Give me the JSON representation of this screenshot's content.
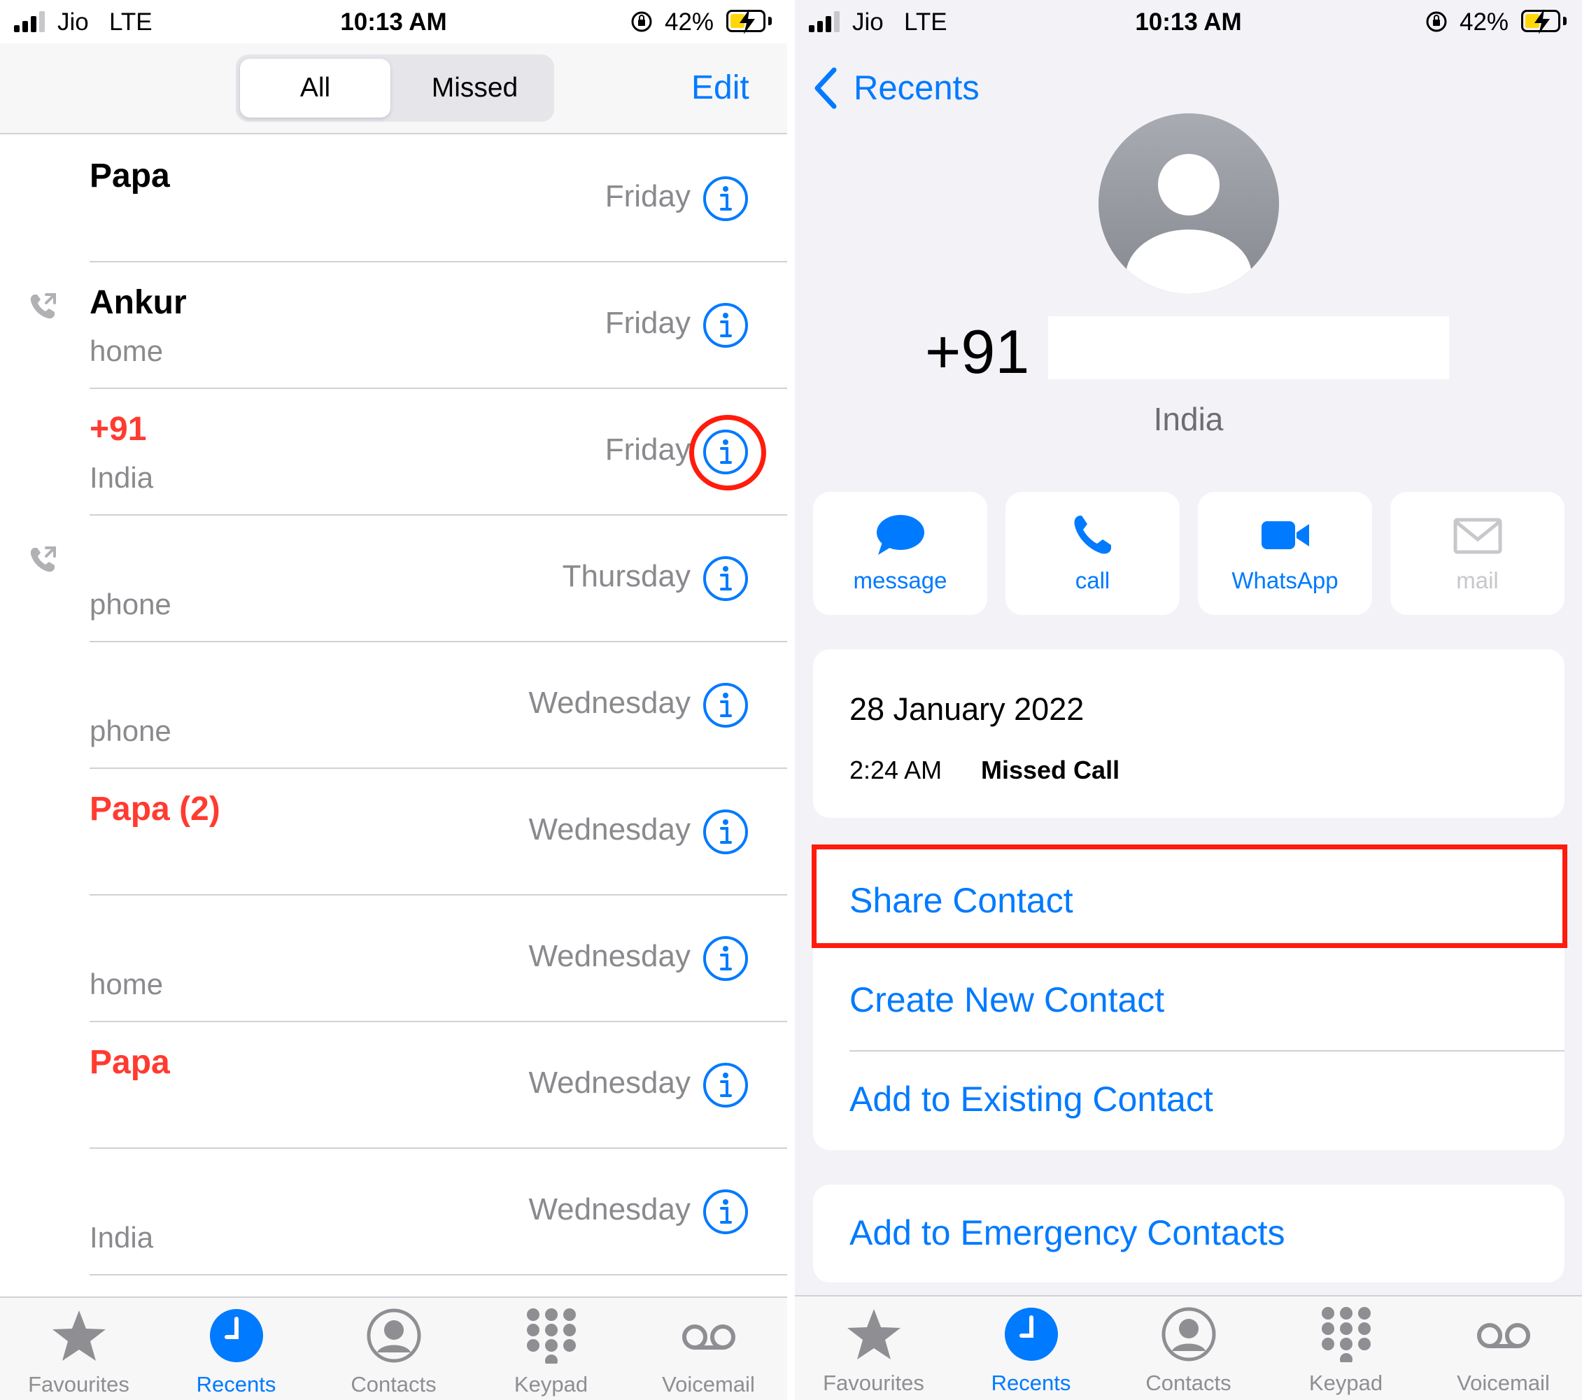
{
  "status_bar": {
    "carrier": "Jio",
    "network": "LTE",
    "time": "10:13 AM",
    "battery": "42%"
  },
  "recents_screen": {
    "segments": [
      "All",
      "Missed"
    ],
    "edit_label": "Edit",
    "calls": [
      {
        "name": "Papa",
        "subtitle": "",
        "day": "Friday",
        "missed": false,
        "outgoing": false
      },
      {
        "name": "Ankur",
        "subtitle": "home",
        "day": "Friday",
        "missed": false,
        "outgoing": true
      },
      {
        "name": "+91 ",
        "subtitle": "India",
        "day": "Friday",
        "missed": true,
        "outgoing": false,
        "highlighted": true
      },
      {
        "name": "",
        "subtitle": "phone",
        "day": "Thursday",
        "missed": false,
        "outgoing": true
      },
      {
        "name": "",
        "subtitle": "phone",
        "day": "Wednesday",
        "missed": false,
        "outgoing": false
      },
      {
        "name": "Papa (2)",
        "subtitle": "",
        "day": "Wednesday",
        "missed": true,
        "outgoing": false
      },
      {
        "name": "",
        "subtitle": "home",
        "day": "Wednesday",
        "missed": false,
        "outgoing": false
      },
      {
        "name": "Papa",
        "subtitle": "",
        "day": "Wednesday",
        "missed": true,
        "outgoing": false
      },
      {
        "name": "",
        "subtitle": "India",
        "day": "Wednesday",
        "missed": false,
        "outgoing": false
      }
    ]
  },
  "tab_bar": {
    "tabs": [
      {
        "label": "Favourites",
        "icon": "star-icon",
        "active": false
      },
      {
        "label": "Recents",
        "icon": "clock-icon",
        "active": true
      },
      {
        "label": "Contacts",
        "icon": "person-circle-icon",
        "active": false
      },
      {
        "label": "Keypad",
        "icon": "keypad-icon",
        "active": false
      },
      {
        "label": "Voicemail",
        "icon": "voicemail-icon",
        "active": false
      }
    ]
  },
  "detail_screen": {
    "back_label": "Recents",
    "phone_number": "+91",
    "country": "India",
    "actions": [
      {
        "label": "message",
        "icon": "message-bubble-icon",
        "enabled": true
      },
      {
        "label": "call",
        "icon": "phone-icon",
        "enabled": true
      },
      {
        "label": "WhatsApp",
        "icon": "video-icon",
        "enabled": true
      },
      {
        "label": "mail",
        "icon": "envelope-icon",
        "enabled": false
      }
    ],
    "call_log": {
      "date": "28 January 2022",
      "time": "2:24 AM",
      "status": "Missed Call"
    },
    "options": [
      "Share Contact",
      "Create New Contact",
      "Add to Existing Contact"
    ],
    "emergency": "Add to Emergency Contacts"
  },
  "colors": {
    "accent": "#007aff",
    "missed": "#ff3b30",
    "highlight": "#ff1c0c",
    "secondary_text": "#8a8a8e"
  }
}
